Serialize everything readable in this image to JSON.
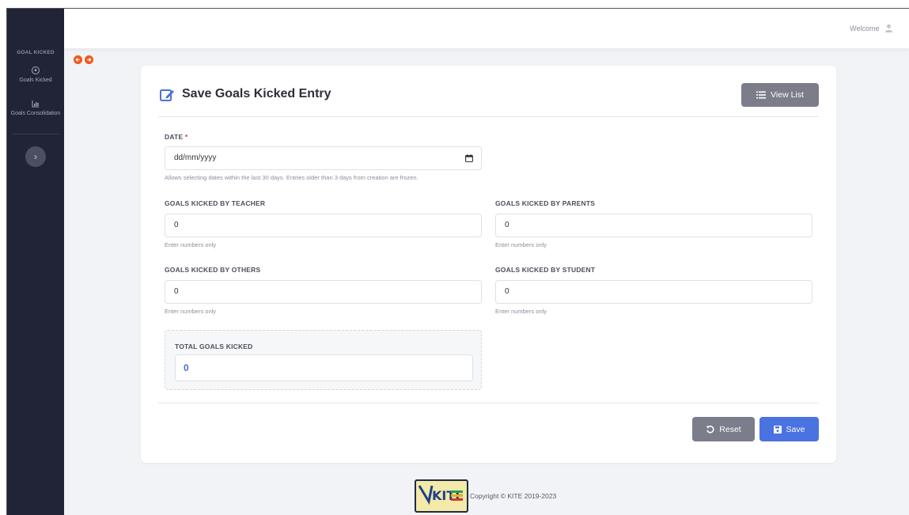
{
  "sidebar": {
    "brand": "GOAL KICKED",
    "items": [
      {
        "label": "Goals Kicked",
        "icon": "soccer-ball-icon"
      },
      {
        "label": "Goals Consolidation",
        "icon": "bar-chart-icon"
      }
    ],
    "toggle_icon": "chevron-right-icon"
  },
  "header": {
    "welcome": "Welcome",
    "user_icon": "user-icon"
  },
  "card": {
    "title": "Save Goals Kicked Entry",
    "view_list_label": "View List",
    "date": {
      "label": "DATE",
      "required_mark": "*",
      "placeholder": "dd/mm/yyyy",
      "hint": "Allows selecting dates within the last 30 days. Entries older than 3 days from creation are frozen."
    },
    "fields": [
      {
        "label": "GOALS KICKED BY TEACHER",
        "value": "0",
        "hint": "Enter numbers only"
      },
      {
        "label": "GOALS KICKED BY PARENTS",
        "value": "0",
        "hint": "Enter numbers only"
      },
      {
        "label": "GOALS KICKED BY OTHERS",
        "value": "0",
        "hint": "Enter numbers only"
      },
      {
        "label": "GOALS KICKED BY STUDENT",
        "value": "0",
        "hint": "Enter numbers only"
      }
    ],
    "total": {
      "label": "TOTAL GOALS KICKED",
      "value": "0"
    },
    "reset_label": "Reset",
    "save_label": "Save"
  },
  "footer": {
    "copyright": "Copyright © KITE 2019-2023",
    "logo_text": "KITE"
  },
  "colors": {
    "sidebar_bg": "#202436",
    "primary": "#4a72e0",
    "secondary": "#7b7e8a",
    "required": "#e0314b",
    "accent_orange": "#f05a1e"
  }
}
